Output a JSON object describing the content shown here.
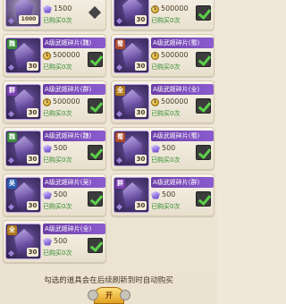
{
  "title_label": "A级武姬碎片",
  "bought_label": "已购买0次",
  "footer_note": "勾选的道具会在后续刷新到时自动购买",
  "open_button_label": "开",
  "top_row": [
    {
      "price": "1500",
      "currency": "gem",
      "lvl": "1000",
      "checked": "none"
    },
    {
      "price": "500000",
      "currency": "coin",
      "lvl": "30",
      "checked": "yes"
    }
  ],
  "cards": [
    {
      "tag": "魏",
      "tag_color": "#3a8f3a",
      "suffix": "(魏)",
      "price": "500000",
      "currency": "coin",
      "lvl": "30"
    },
    {
      "tag": "蜀",
      "tag_color": "#b04a2a",
      "suffix": "(蜀)",
      "price": "500000",
      "currency": "coin",
      "lvl": "30"
    },
    {
      "tag": "群",
      "tag_color": "#7a3fb0",
      "suffix": "(群)",
      "price": "500000",
      "currency": "coin",
      "lvl": "30"
    },
    {
      "tag": "全",
      "tag_color": "#b07a1a",
      "suffix": "(全)",
      "price": "500000",
      "currency": "coin",
      "lvl": "30"
    },
    {
      "tag": "魏",
      "tag_color": "#3a8f3a",
      "suffix": "(魏)",
      "price": "500",
      "currency": "gem",
      "lvl": "30"
    },
    {
      "tag": "蜀",
      "tag_color": "#b04a2a",
      "suffix": "(蜀)",
      "price": "500",
      "currency": "gem",
      "lvl": "30"
    },
    {
      "tag": "吴",
      "tag_color": "#2a5ab0",
      "suffix": "(吴)",
      "price": "500",
      "currency": "gem",
      "lvl": "30"
    },
    {
      "tag": "群",
      "tag_color": "#7a3fb0",
      "suffix": "(群)",
      "price": "500",
      "currency": "gem",
      "lvl": "30"
    },
    {
      "tag": "全",
      "tag_color": "#b07a1a",
      "suffix": "(全)",
      "price": "500",
      "currency": "gem",
      "lvl": "30"
    }
  ],
  "colors": {
    "title_bg": "#7c4fbf",
    "bought_text": "#2f8a2c",
    "check_mark": "#5cd04a"
  }
}
